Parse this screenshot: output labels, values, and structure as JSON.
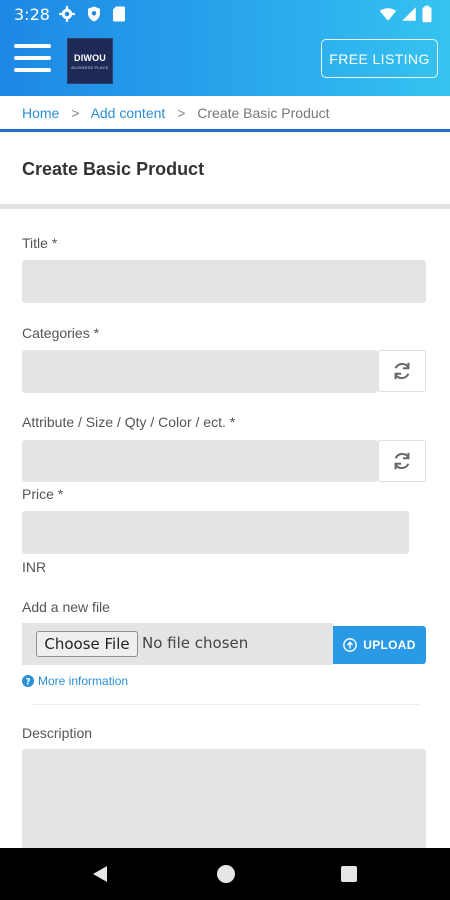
{
  "status_bar": {
    "time": "3:28"
  },
  "header": {
    "logo_main": "DIWOU",
    "logo_sub": "BUSINESS PLACE",
    "free_listing_label": "FREE LISTING"
  },
  "breadcrumb": {
    "items": [
      "Home",
      "Add content",
      "Create Basic Product"
    ]
  },
  "page": {
    "title": "Create Basic Product"
  },
  "form": {
    "title_label": "Title *",
    "categories_label": "Categories *",
    "attribute_label": "Attribute / Size / Qty / Color / ect. *",
    "price_label": "Price *",
    "currency": "INR",
    "file_label": "Add a new file",
    "choose_file_label": "Choose File",
    "file_status": "No file chosen",
    "upload_label": "UPLOAD",
    "more_info_label": "More information",
    "description_label": "Description"
  },
  "colors": {
    "accent": "#2a9ae6",
    "header_start": "#1e88e5",
    "header_end": "#36c3f0",
    "field_bg": "#e3e4e6"
  }
}
